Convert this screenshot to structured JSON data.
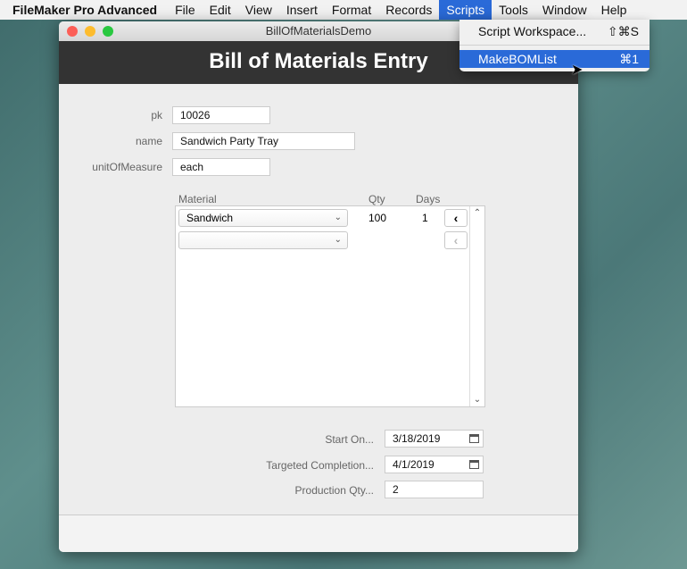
{
  "menubar": {
    "app": "FileMaker Pro Advanced",
    "items": [
      "File",
      "Edit",
      "View",
      "Insert",
      "Format",
      "Records",
      "Scripts",
      "Tools",
      "Window",
      "Help"
    ]
  },
  "scripts_menu": {
    "items": [
      {
        "label": "Script Workspace...",
        "shortcut": "⇧⌘S"
      },
      {
        "label": "MakeBOMList",
        "shortcut": "⌘1"
      }
    ]
  },
  "window": {
    "title": "BillOfMaterialsDemo",
    "header": "Bill of Materials Entry"
  },
  "form": {
    "pk_label": "pk",
    "pk": "10026",
    "name_label": "name",
    "name": "Sandwich Party Tray",
    "uom_label": "unitOfMeasure",
    "uom": "each"
  },
  "portal": {
    "headers": {
      "material": "Material",
      "qty": "Qty",
      "days": "Days"
    },
    "rows": [
      {
        "material": "Sandwich",
        "qty": "100",
        "days": "1"
      },
      {
        "material": "",
        "qty": "",
        "days": ""
      }
    ]
  },
  "production": {
    "start_label": "Start On...",
    "start": "3/18/2019",
    "target_label": "Targeted Completion...",
    "target": "4/1/2019",
    "qty_label": "Production Qty...",
    "qty": "2"
  }
}
